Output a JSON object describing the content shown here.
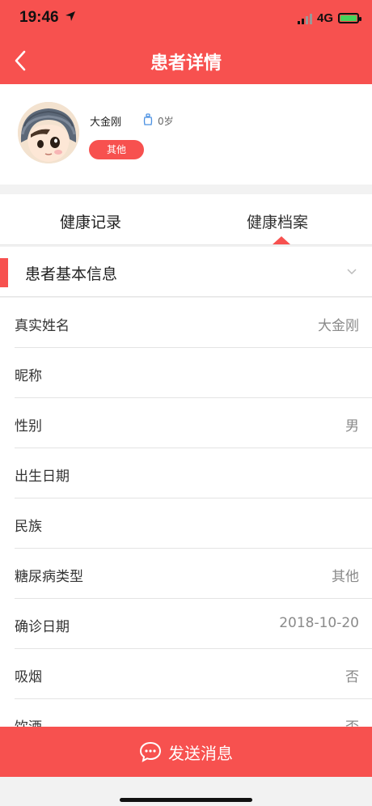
{
  "status_bar": {
    "time": "19:46",
    "network": "4G"
  },
  "navbar": {
    "title": "患者详情"
  },
  "profile": {
    "name": "大金刚",
    "age": "0岁",
    "type_badge": "其他"
  },
  "tabs": [
    {
      "label": "健康记录",
      "active": false
    },
    {
      "label": "健康档案",
      "active": true
    }
  ],
  "section": {
    "title": "患者基本信息"
  },
  "fields": [
    {
      "label": "真实姓名",
      "value": "大金刚"
    },
    {
      "label": "昵称",
      "value": ""
    },
    {
      "label": "性别",
      "value": "男"
    },
    {
      "label": "出生日期",
      "value": ""
    },
    {
      "label": "民族",
      "value": ""
    },
    {
      "label": "糖尿病类型",
      "value": "其他"
    },
    {
      "label": "确诊日期",
      "value": "2018-10-20"
    },
    {
      "label": "吸烟",
      "value": "否"
    },
    {
      "label": "饮酒",
      "value": "否"
    }
  ],
  "footer": {
    "send_label": "发送消息"
  },
  "colors": {
    "primary": "#f7514f",
    "accent_icon": "#4a90e2"
  }
}
